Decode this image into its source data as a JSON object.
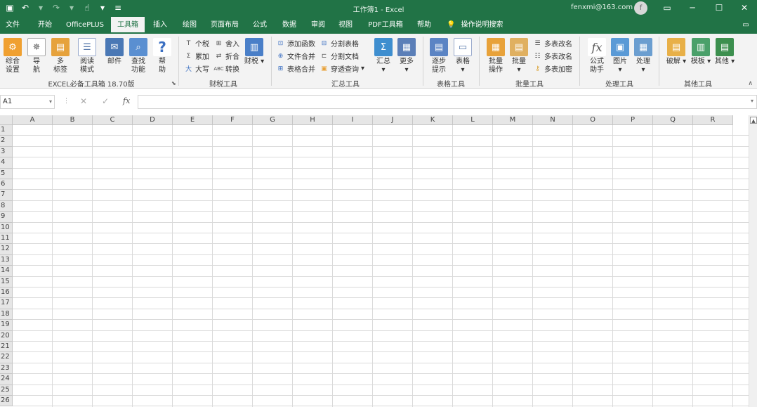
{
  "titlebar": {
    "title": "工作簿1 - Excel",
    "account": "fenxmi@163.com",
    "avatar_initial": "f",
    "qat_icons": [
      "save-icon",
      "undo-icon",
      "redo-icon",
      "touch-mode-icon",
      "customize-qat-icon"
    ]
  },
  "tabs": [
    {
      "label": "文件"
    },
    {
      "label": "开始"
    },
    {
      "label": "OfficePLUS"
    },
    {
      "label": "工具箱",
      "active": true
    },
    {
      "label": "插入"
    },
    {
      "label": "绘图"
    },
    {
      "label": "页面布局"
    },
    {
      "label": "公式"
    },
    {
      "label": "数据"
    },
    {
      "label": "审阅"
    },
    {
      "label": "视图"
    },
    {
      "label": "PDF工具箱"
    },
    {
      "label": "帮助"
    }
  ],
  "tell_me": "操作说明搜索",
  "ribbon": {
    "big_buttons": [
      {
        "label": "综合\n设置",
        "icon": "settings-icon",
        "color": "#f0a030"
      },
      {
        "label": "导\n航",
        "icon": "compass-icon",
        "color": "#6b6b6b"
      },
      {
        "label": "多\n标签",
        "icon": "tabs-icon",
        "color": "#e6a23c"
      },
      {
        "label": "阅读\n模式",
        "icon": "reading-icon",
        "color": "#7aa3d6"
      },
      {
        "label": "邮件",
        "icon": "mail-icon",
        "color": "#4a78b5"
      },
      {
        "label": "查找\n功能",
        "icon": "find-icon",
        "color": "#5a8fd1"
      },
      {
        "label": "帮\n助",
        "icon": "help-icon",
        "color": "#3b6fc2"
      }
    ],
    "group1_label": "EXCEL必备工具箱 18.70版",
    "finance_small": [
      {
        "label": "个税",
        "icon": "t-icon"
      },
      {
        "label": "舍入",
        "icon": "round-icon"
      },
      {
        "label": "累加",
        "icon": "sigma-icon"
      },
      {
        "label": "折合",
        "icon": "convert-icon"
      },
      {
        "label": "大写",
        "icon": "uppercase-icon"
      },
      {
        "label": "转换",
        "icon": "abc-icon"
      }
    ],
    "finance_more": "财税",
    "group2_label": "财税工具",
    "summary_small": [
      {
        "label": "添加函数",
        "icon": "function-icon"
      },
      {
        "label": "分割表格",
        "icon": "split-table-icon"
      },
      {
        "label": "文件合并",
        "icon": "merge-files-icon"
      },
      {
        "label": "分割文档",
        "icon": "split-doc-icon"
      },
      {
        "label": "表格合并",
        "icon": "merge-table-icon"
      },
      {
        "label": "穿透查询",
        "icon": "drill-query-icon"
      }
    ],
    "summary_big": [
      {
        "label": "汇总",
        "icon": "summary-icon",
        "color": "#3e8ecf"
      },
      {
        "label": "更多",
        "icon": "more-icon",
        "color": "#5b7fb8"
      }
    ],
    "group3_label": "汇总工具",
    "table_big": [
      {
        "label": "逐步\n提示",
        "icon": "step-hint-icon",
        "color": "#5b84c4"
      },
      {
        "label": "表格",
        "icon": "table-icon",
        "color": "#8fb0d8"
      }
    ],
    "group4_label": "表格工具",
    "batch_big": [
      {
        "label": "批量\n操作",
        "icon": "batch-op-icon",
        "color": "#e8a23a"
      },
      {
        "label": "批量",
        "icon": "batch-icon",
        "color": "#e0b060"
      }
    ],
    "batch_small": [
      {
        "label": "多表改名",
        "icon": "rename-icon"
      },
      {
        "label": "多表改名",
        "icon": "rename2-icon"
      },
      {
        "label": "多表加密",
        "icon": "key-icon"
      }
    ],
    "group5_label": "批量工具",
    "process_big": [
      {
        "label": "公式\n助手",
        "icon": "fx-icon",
        "color": "#666666"
      },
      {
        "label": "图片",
        "icon": "image-icon",
        "color": "#5a9ad6"
      },
      {
        "label": "处理",
        "icon": "process-icon",
        "color": "#6b9ed0"
      }
    ],
    "group6_label": "处理工具",
    "other_big": [
      {
        "label": "破解",
        "icon": "crack-icon",
        "color": "#e8b048"
      },
      {
        "label": "模板",
        "icon": "template-icon",
        "color": "#4aa06a"
      },
      {
        "label": "其他",
        "icon": "other-icon",
        "color": "#3c8f4e"
      }
    ],
    "group7_label": "其他工具"
  },
  "formula_bar": {
    "name_box": "A1",
    "fx_symbol": "fx",
    "cancel_symbol": "✕",
    "confirm_symbol": "✓",
    "value": ""
  },
  "grid": {
    "columns": [
      "A",
      "B",
      "C",
      "D",
      "E",
      "F",
      "G",
      "H",
      "I",
      "J",
      "K",
      "L",
      "M",
      "N",
      "O",
      "P",
      "Q",
      "R"
    ],
    "rows": [
      "1",
      "2",
      "3",
      "4",
      "5",
      "6",
      "7",
      "8",
      "9",
      "10",
      "11",
      "12",
      "13",
      "14",
      "15",
      "16",
      "17",
      "18",
      "19",
      "20",
      "21",
      "22",
      "23",
      "24",
      "25",
      "26"
    ]
  }
}
